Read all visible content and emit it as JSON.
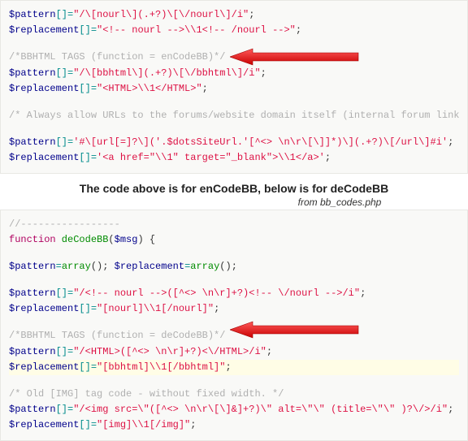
{
  "block1": {
    "l1_var": "$pattern",
    "l1_idx": "[]",
    "l1_eq": "=",
    "l1_str": "\"/\\[nourl\\](.+?)\\[\\/nourl\\]/i\"",
    "l1_semi": ";",
    "l2_var": "$replacement",
    "l2_idx": "[]",
    "l2_eq": "=",
    "l2_str": "\"<!-- nourl -->\\\\1<!-- /nourl -->\"",
    "l2_semi": ";",
    "c1": "/*BBHTML TAGS (function = enCodeBB)*/",
    "l3_var": "$pattern",
    "l3_idx": "[]",
    "l3_eq": "=",
    "l3_str": "\"/\\[bbhtml\\](.+?)\\[\\/bbhtml\\]/i\"",
    "l3_semi": ";",
    "l4_var": "$replacement",
    "l4_idx": "[]",
    "l4_eq": "=",
    "l4_str": "\"<HTML>\\\\1</HTML>\"",
    "l4_semi": ";",
    "c2": "/* Always allow URLs to the forums/website domain itself (internal forum links) */",
    "l5_var": "$pattern",
    "l5_idx": "[]",
    "l5_eq": "=",
    "l5_str": "'#\\[url[=]?\\]('.$dotsSiteUrl.'[^<> \\n\\r\\[\\]]*)\\](.+?)\\[/url\\]#i'",
    "l5_semi": ";",
    "l6_var": "$replacement",
    "l6_idx": "[]",
    "l6_eq": "=",
    "l6_str": "'<a href=\"\\\\1\" target=\"_blank\">\\\\1</a>'",
    "l6_semi": ";"
  },
  "caption": "The code above is for enCodeBB, below is for deCodeBB",
  "subcaption": "from bb_codes.php",
  "block2": {
    "c0": "//-----------------",
    "fn_kw": "function",
    "fn_name": " deCodeBB",
    "fn_open": "(",
    "fn_var": "$msg",
    "fn_close": ") {",
    "l1_var": "$pattern",
    "l1_eq": "=",
    "l1_call": "array",
    "l1_paren": "()",
    "l1_semi": ";",
    "l1b_var": " $replacement",
    "l1b_eq": "=",
    "l1b_call": "array",
    "l1b_paren": "()",
    "l1b_semi": ";",
    "l2_var": "$pattern",
    "l2_idx": "[]",
    "l2_eq": "=",
    "l2_str": "\"/<!-- nourl -->([^<> \\n\\r]+?)<!-- \\/nourl -->/i\"",
    "l2_semi": ";",
    "l3_var": "$replacement",
    "l3_idx": "[]",
    "l3_eq": "=",
    "l3_str": "\"[nourl]\\\\1[/nourl]\"",
    "l3_semi": ";",
    "c1": "/*BBHTML TAGS (function = deCodeBB)*/",
    "l4_var": "$pattern",
    "l4_idx": "[]",
    "l4_eq": "=",
    "l4_str": "\"/<HTML>([^<> \\n\\r]+?)<\\/HTML>/i\"",
    "l4_semi": ";",
    "l5_var": "$replacement",
    "l5_idx": "[]",
    "l5_eq": "=",
    "l5_str": "\"[bbhtml]\\\\1[/bbhtml]\"",
    "l5_semi": ";",
    "c2": "/* Old [IMG] tag code - without fixed width. */",
    "l6_var": "$pattern",
    "l6_idx": "[]",
    "l6_eq": "=",
    "l6_str": "\"/<img src=\\\"([^<> \\n\\r\\[\\]&]+?)\\\" alt=\\\"\\\" (title=\\\"\\\" )?\\/>/i\"",
    "l6_semi": ";",
    "l7_var": "$replacement",
    "l7_idx": "[]",
    "l7_eq": "=",
    "l7_str": "\"[img]\\\\1[/img]\"",
    "l7_semi": ";"
  }
}
